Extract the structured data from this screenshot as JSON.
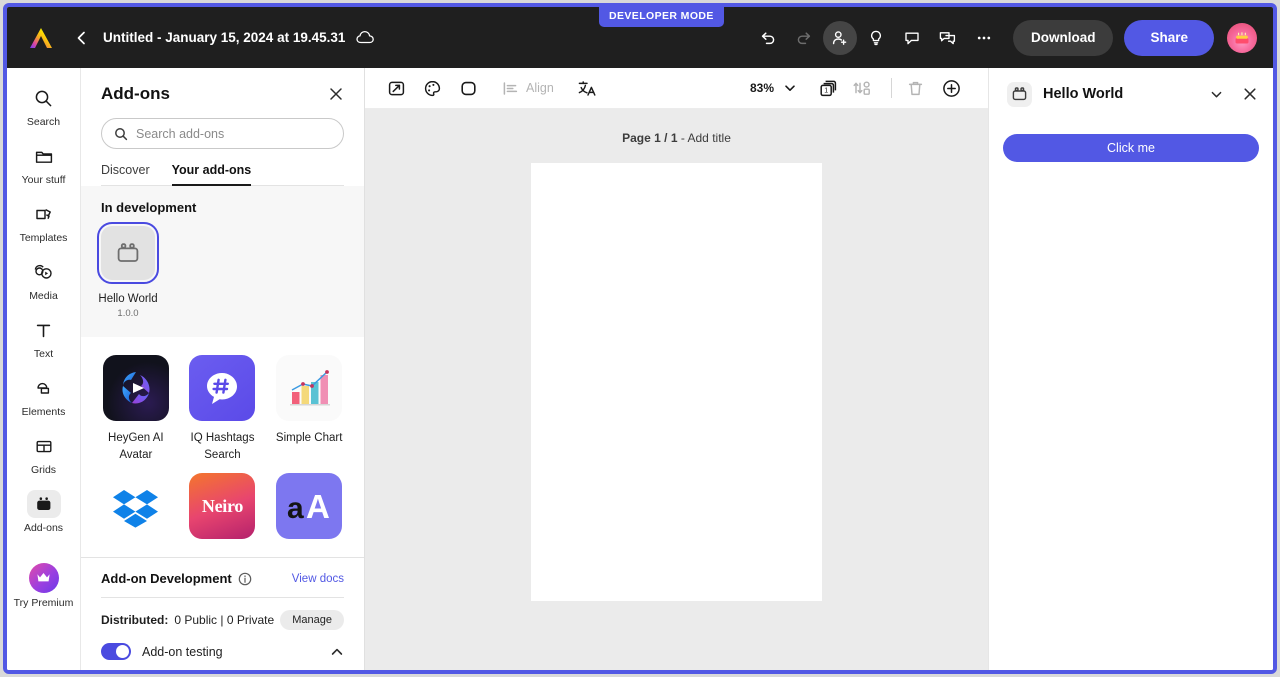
{
  "dev_mode_badge": "DEVELOPER MODE",
  "topbar": {
    "logo_icon": "adobe-express-logo",
    "back_icon": "chevron-left-icon",
    "doc_title": "Untitled - January 15, 2024 at 19.45.31",
    "cloud_icon": "cloud-icon",
    "undo_icon": "undo-icon",
    "redo_icon": "redo-icon",
    "invite_icon": "add-person-icon",
    "ideas_icon": "lightbulb-icon",
    "comment_icon": "comment-icon",
    "duplicate_icon": "duplicate-comment-icon",
    "more_icon": "more-options-icon",
    "download_label": "Download",
    "share_label": "Share",
    "avatar_icon": "user-avatar",
    "share_color": "#5258e4",
    "download_color": "#3c3c3c"
  },
  "left_rail": {
    "items": [
      {
        "label": "Search",
        "icon": "search-icon",
        "name": "search",
        "active": false
      },
      {
        "label": "Your stuff",
        "icon": "folder-icon",
        "name": "your-stuff",
        "active": false
      },
      {
        "label": "Templates",
        "icon": "templates-icon",
        "name": "templates",
        "active": false
      },
      {
        "label": "Media",
        "icon": "media-icon",
        "name": "media",
        "active": false
      },
      {
        "label": "Text",
        "icon": "text-icon",
        "name": "text",
        "active": false
      },
      {
        "label": "Elements",
        "icon": "elements-icon",
        "name": "elements",
        "active": false
      },
      {
        "label": "Grids",
        "icon": "grids-icon",
        "name": "grids",
        "active": false
      },
      {
        "label": "Add-ons",
        "icon": "addons-icon",
        "name": "add-ons",
        "active": true
      }
    ],
    "premium": {
      "label": "Try Premium",
      "icon": "crown-icon"
    }
  },
  "addons_panel": {
    "title": "Add-ons",
    "close_icon": "close-icon",
    "search": {
      "placeholder": "Search add-ons",
      "icon": "search-icon",
      "value": ""
    },
    "tabs": [
      {
        "label": "Discover",
        "active": false
      },
      {
        "label": "Your add-ons",
        "active": true
      }
    ],
    "in_development": {
      "title": "In development",
      "addon": {
        "name": "Hello World",
        "version": "1.0.0",
        "icon": "addon-brick-icon",
        "selected": true,
        "selection_color": "#4a4ae0"
      }
    },
    "grid": [
      {
        "name": "HeyGen AI Avatar",
        "icon": "heygen-logo"
      },
      {
        "name": "IQ Hashtags Search",
        "icon": "hashtag-bubble-logo"
      },
      {
        "name": "Simple Chart",
        "icon": "bar-chart-logo"
      },
      {
        "name": "",
        "icon": "dropbox-logo"
      },
      {
        "name": "",
        "icon": "neiro-logo"
      },
      {
        "name": "",
        "icon": "aa-typography-logo"
      }
    ],
    "footer": {
      "title": "Add-on Development",
      "info_icon": "info-icon",
      "view_docs_label": "View docs",
      "view_docs_color": "#5258e4",
      "distributed_label": "Distributed:",
      "distributed_value": "0 Public | 0 Private",
      "manage_label": "Manage",
      "testing_label": "Add-on testing",
      "testing_enabled": true,
      "collapse_icon": "chevron-up-icon"
    }
  },
  "canvas": {
    "toolbar": {
      "resize_icon": "resize-icon",
      "palette_icon": "color-palette-icon",
      "shape_icon": "shape-icon",
      "align_icon": "align-icon",
      "align_label": "Align",
      "translate_icon": "translate-icon",
      "zoom_value": "83%",
      "zoom_chevron_icon": "chevron-down-icon",
      "pages_icon": "pages-icon",
      "arrange_icon": "arrange-icon",
      "delete_icon": "trash-icon",
      "add_icon": "add-page-icon"
    },
    "page_label_bold": "Page 1 / 1",
    "page_label_rest": " - Add title"
  },
  "right_panel": {
    "title": "Hello World",
    "icon": "addon-brick-icon",
    "chevron_icon": "chevron-down-icon",
    "close_icon": "close-icon",
    "button_label": "Click me",
    "button_color": "#5258e4"
  }
}
